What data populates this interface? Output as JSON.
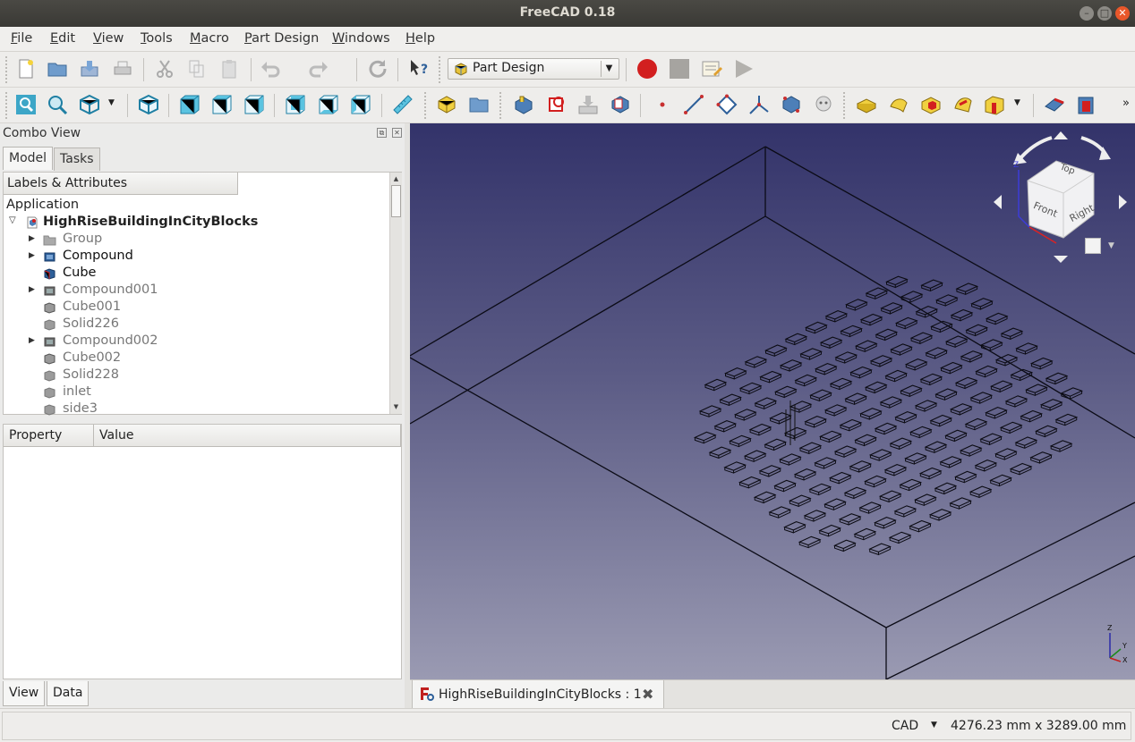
{
  "window": {
    "title": "FreeCAD 0.18"
  },
  "menu": [
    "File",
    "Edit",
    "View",
    "Tools",
    "Macro",
    "Part Design",
    "Windows",
    "Help"
  ],
  "workbench": {
    "selected": "Part Design"
  },
  "combo": {
    "title": "Combo View",
    "tabs": [
      "Model",
      "Tasks"
    ],
    "tree_header": "Labels & Attributes",
    "root": "Application",
    "document": "HighRiseBuildingInCityBlocks",
    "items": [
      {
        "label": "Group",
        "expandable": true,
        "visible": false,
        "icon": "folder-icon"
      },
      {
        "label": "Compound",
        "expandable": true,
        "visible": true,
        "icon": "compound-icon"
      },
      {
        "label": "Cube",
        "expandable": false,
        "visible": true,
        "icon": "cube-icon"
      },
      {
        "label": "Compound001",
        "expandable": true,
        "visible": false,
        "icon": "compound-icon"
      },
      {
        "label": "Cube001",
        "expandable": false,
        "visible": false,
        "icon": "cube-icon"
      },
      {
        "label": "Solid226",
        "expandable": false,
        "visible": false,
        "icon": "solid-icon"
      },
      {
        "label": "Compound002",
        "expandable": true,
        "visible": false,
        "icon": "compound-icon"
      },
      {
        "label": "Cube002",
        "expandable": false,
        "visible": false,
        "icon": "cube-icon"
      },
      {
        "label": "Solid228",
        "expandable": false,
        "visible": false,
        "icon": "solid-icon"
      },
      {
        "label": "inlet",
        "expandable": false,
        "visible": false,
        "icon": "solid-icon"
      },
      {
        "label": "side3",
        "expandable": false,
        "visible": false,
        "icon": "solid-icon"
      }
    ],
    "property_headers": [
      "Property",
      "Value"
    ],
    "bottom_tabs": [
      "View",
      "Data"
    ]
  },
  "navcube": {
    "top": "Top",
    "front": "Front",
    "right": "Right"
  },
  "axis": {
    "x": "X",
    "y": "Y",
    "z": "Z"
  },
  "document_tab": {
    "label": "HighRiseBuildingInCityBlocks : 1"
  },
  "status": {
    "navigation": "CAD",
    "dimensions": "4276.23 mm x 3289.00 mm"
  },
  "colors": {
    "accent": "#2d7fb8",
    "record": "#d21f1f",
    "close": "#e9572a",
    "bg_top": "#33336a",
    "bg_bottom": "#9a9ab2"
  }
}
